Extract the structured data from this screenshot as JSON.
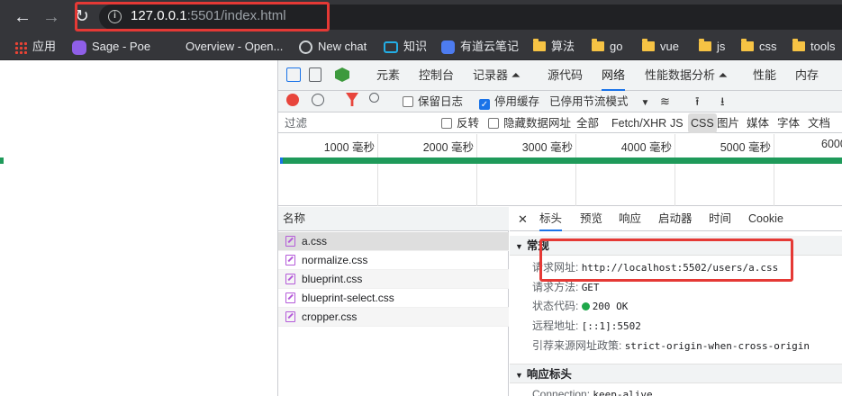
{
  "browser": {
    "url_host": "127.0.0.1",
    "url_rest": ":5501/index.html"
  },
  "bookmarks": [
    {
      "label": "应用",
      "icon": "apps-grid-icon"
    },
    {
      "label": "Sage - Poe",
      "icon": "poe-icon"
    },
    {
      "label": "Overview - Open...",
      "icon": "openai-icon"
    },
    {
      "label": "New chat",
      "icon": "chatgpt-icon"
    },
    {
      "label": "知识",
      "icon": "bilibili-icon"
    },
    {
      "label": "有道云笔记",
      "icon": "youdao-icon"
    },
    {
      "label": "算法",
      "icon": "folder-icon"
    },
    {
      "label": "go",
      "icon": "folder-icon"
    },
    {
      "label": "vue",
      "icon": "folder-icon"
    },
    {
      "label": "js",
      "icon": "folder-icon"
    },
    {
      "label": "css",
      "icon": "folder-icon"
    },
    {
      "label": "tools",
      "icon": "folder-icon"
    }
  ],
  "devtools": {
    "tabs": [
      "元素",
      "控制台",
      "记录器 ⏶",
      "源代码",
      "网络",
      "性能数据分析 ⏶",
      "性能",
      "内存"
    ],
    "active_tab": "网络",
    "toolbar": {
      "preserve_log": "保留日志",
      "disable_cache": "停用缓存",
      "throttle": "已停用节流模式"
    },
    "filter": {
      "placeholder": "过滤",
      "invert": "反转",
      "hide_data_urls": "隐藏数据网址",
      "types": [
        "全部",
        "Fetch/XHR",
        "JS",
        "CSS",
        "图片",
        "媒体",
        "字体",
        "文档"
      ]
    },
    "timeline_ticks": [
      "1000 毫秒",
      "2000 毫秒",
      "3000 毫秒",
      "4000 毫秒",
      "5000 毫秒",
      "6000"
    ],
    "name_header": "名称",
    "requests": [
      "a.css",
      "normalize.css",
      "blueprint.css",
      "blueprint-select.css",
      "cropper.css"
    ],
    "detail_tabs": [
      "标头",
      "预览",
      "响应",
      "启动器",
      "时间",
      "Cookie"
    ],
    "general": {
      "title": "常规",
      "request_url_key": "请求网址:",
      "request_url": "http://localhost:5502/users/a.css",
      "method_key": "请求方法:",
      "method": "GET",
      "status_key": "状态代码:",
      "status": "200 OK",
      "remote_key": "远程地址:",
      "remote": "[::1]:5502",
      "referrer_key": "引荐来源网址政策:",
      "referrer": "strict-origin-when-cross-origin"
    },
    "response_headers": {
      "title": "响应标头",
      "connection_key": "Connection:",
      "connection": "keep-alive"
    }
  }
}
